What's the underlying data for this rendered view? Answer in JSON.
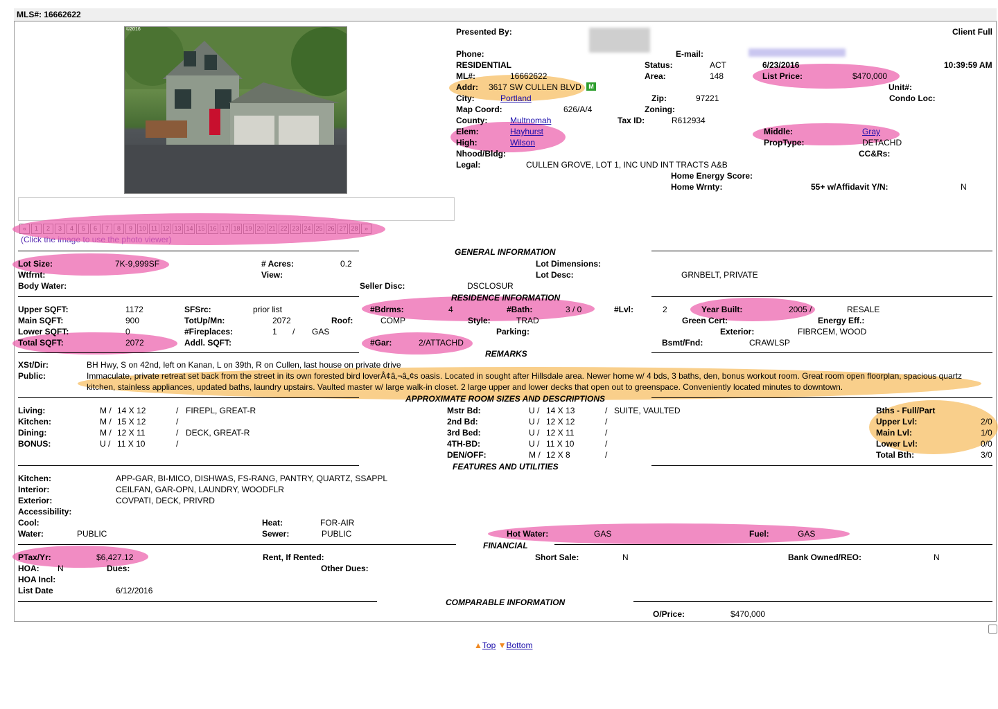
{
  "mls_header": "MLS#: 16662622",
  "photo_viewer_hint": "(Click the image to use the photo viewer)",
  "photo_caption": "©2016",
  "pager": [
    "«",
    "1",
    "2",
    "3",
    "4",
    "5",
    "6",
    "7",
    "8",
    "9",
    "10",
    "11",
    "12",
    "13",
    "14",
    "15",
    "16",
    "17",
    "18",
    "19",
    "20",
    "21",
    "22",
    "23",
    "24",
    "25",
    "26",
    "27",
    "28",
    "»"
  ],
  "listing": {
    "presented_by_label": "Presented By:",
    "client_full": "Client Full",
    "phone_label": "Phone:",
    "email_label": "E-mail:",
    "type": "RESIDENTIAL",
    "status_label": "Status:",
    "status": "ACT",
    "date": "6/23/2016",
    "time": "10:39:59 AM",
    "ml_label": "ML#:",
    "ml": "16662622",
    "area_label": "Area:",
    "area": "148",
    "list_price_label": "List Price:",
    "list_price": "$470,000",
    "addr_label": "Addr:",
    "addr": "3617 SW CULLEN BLVD",
    "map_badge": "M",
    "unit_label": "Unit#:",
    "city_label": "City:",
    "city": "Portland",
    "zip_label": "Zip:",
    "zip": "97221",
    "condo_label": "Condo Loc:",
    "map_coord_label": "Map Coord:",
    "map_coord": "626/A/4",
    "zoning_label": "Zoning:",
    "county_label": "County:",
    "county": "Multnomah",
    "taxid_label": "Tax ID:",
    "taxid": "R612934",
    "elem_label": "Elem:",
    "elem": "Hayhurst",
    "middle_label": "Middle:",
    "middle": "Gray",
    "high_label": "High:",
    "high": "Wilson",
    "proptype_label": "PropType:",
    "proptype": "DETACHD",
    "nhood_label": "Nhood/Bldg:",
    "ccrs_label": "CC&Rs:",
    "legal_label": "Legal:",
    "legal": "CULLEN GROVE, LOT 1, INC UND INT TRACTS A&B",
    "energy_label": "Home Energy Score:",
    "wrnty_label": "Home Wrnty:",
    "affidavit_label": "55+ w/Affidavit Y/N:",
    "affidavit": "N"
  },
  "general": {
    "title": "GENERAL INFORMATION",
    "lot_size_label": "Lot Size:",
    "lot_size": "7K-9,999SF",
    "acres_label": "# Acres:",
    "acres": "0.2",
    "lot_dim_label": "Lot Dimensions:",
    "wtfrnt_label": "Wtfrnt:",
    "view_label": "View:",
    "lot_desc_label": "Lot Desc:",
    "lot_desc": "GRNBELT, PRIVATE",
    "body_water_label": "Body Water:",
    "seller_disc_label": "Seller Disc:",
    "seller_disc": "DSCLOSUR"
  },
  "residence": {
    "title": "RESIDENCE INFORMATION",
    "upper_label": "Upper SQFT:",
    "upper": "1172",
    "sfsrc_label": "SFSrc:",
    "sfsrc": "prior list",
    "bdrms_label": "#Bdrms:",
    "bdrms": "4",
    "bath_label": "#Bath:",
    "bath": "3 / 0",
    "lvl_label": "#Lvl:",
    "lvl": "2",
    "year_label": "Year Built:",
    "year": "2005 /",
    "resale": "RESALE",
    "main_label": "Main SQFT:",
    "main": "900",
    "totup_label": "TotUp/Mn:",
    "totup": "2072",
    "roof_label": "Roof:",
    "roof": "COMP",
    "style_label": "Style:",
    "style": "TRAD",
    "green_label": "Green Cert:",
    "energy_eff_label": "Energy Eff.:",
    "lower_label": "Lower SQFT:",
    "lower": "0",
    "fireplaces_label": "#Fireplaces:",
    "fireplaces": "1",
    "fp_sep": "/",
    "fp_type": "GAS",
    "parking_label": "Parking:",
    "exterior_label": "Exterior:",
    "exterior": "FIBRCEM, WOOD",
    "total_label": "Total SQFT:",
    "total": "2072",
    "addl_label": "Addl. SQFT:",
    "gar_label": "#Gar:",
    "gar": "2/ATTACHD",
    "bsmt_label": "Bsmt/Fnd:",
    "bsmt": "CRAWLSP"
  },
  "remarks": {
    "title": "REMARKS",
    "xst_label": "XSt/Dir:",
    "xst": "BH Hwy, S on 42nd, left on Kanan, L on 39th, R on Cullen, last house on private drive",
    "public_label": "Public:",
    "public_line1": "Immaculate, private retreat set back from the street in its own forested bird loverÂ¢â‚¬â„¢s oasis. Located in sought after Hillsdale area. Newer home w/ 4 bds, 3 baths, den, bonus workout room. Great room open floorplan, spacious quartz",
    "public_line2": "kitchen, stainless appliances, updated baths, laundry upstairs. Vaulted master w/ large walk-in closet. 2 large upper and lower decks that open out to greenspace. Conveniently located minutes to downtown."
  },
  "rooms": {
    "title": "APPROXIMATE ROOM SIZES AND DESCRIPTIONS",
    "left": [
      {
        "name": "Living:",
        "lvl": "M /",
        "size": "14 X 12",
        "sep": "/",
        "desc": "FIREPL, GREAT-R"
      },
      {
        "name": "Kitchen:",
        "lvl": "M /",
        "size": "15 X 12",
        "sep": "/",
        "desc": ""
      },
      {
        "name": "Dining:",
        "lvl": "M /",
        "size": "12 X 11",
        "sep": "/",
        "desc": "DECK, GREAT-R"
      },
      {
        "name": "BONUS:",
        "lvl": "U /",
        "size": "11 X 10",
        "sep": "/",
        "desc": ""
      }
    ],
    "right": [
      {
        "name": "Mstr Bd:",
        "lvl": "U /",
        "size": "14 X 13",
        "sep": "/",
        "desc": "SUITE, VAULTED"
      },
      {
        "name": "2nd Bd:",
        "lvl": "U /",
        "size": "12 X 12",
        "sep": "/",
        "desc": ""
      },
      {
        "name": "3rd Bed:",
        "lvl": "U /",
        "size": "12 X 11",
        "sep": "/",
        "desc": ""
      },
      {
        "name": "4TH-BD:",
        "lvl": "U /",
        "size": "11 X 10",
        "sep": "/",
        "desc": ""
      },
      {
        "name": "DEN/OFF:",
        "lvl": "M /",
        "size": "12 X 8",
        "sep": "/",
        "desc": ""
      }
    ],
    "baths_title": "Bths - Full/Part",
    "baths": [
      {
        "name": "Upper Lvl:",
        "val": "2/0"
      },
      {
        "name": "Main Lvl:",
        "val": "1/0"
      },
      {
        "name": "Lower Lvl:",
        "val": "0/0"
      },
      {
        "name": "Total Bth:",
        "val": "3/0"
      }
    ]
  },
  "features": {
    "title": "FEATURES AND UTILITIES",
    "kitchen_label": "Kitchen:",
    "kitchen": "APP-GAR, BI-MICO, DISHWAS, FS-RANG, PANTRY, QUARTZ, SSAPPL",
    "interior_label": "Interior:",
    "interior": "CEILFAN, GAR-OPN, LAUNDRY, WOODFLR",
    "exterior_label": "Exterior:",
    "exterior": "COVPATI, DECK, PRIVRD",
    "access_label": "Accessibility:",
    "cool_label": "Cool:",
    "heat_label": "Heat:",
    "heat": "FOR-AIR",
    "water_label": "Water:",
    "water": "PUBLIC",
    "sewer_label": "Sewer:",
    "sewer": "PUBLIC",
    "hotwater_label": "Hot Water:",
    "hotwater": "GAS",
    "fuel_label": "Fuel:",
    "fuel": "GAS"
  },
  "financial": {
    "title": "FINANCIAL",
    "ptax_label": "PTax/Yr:",
    "ptax": "$6,427.12",
    "rent_label": "Rent, If Rented:",
    "short_label": "Short Sale:",
    "short": "N",
    "bank_label": "Bank Owned/REO:",
    "bank": "N",
    "hoa_label": "HOA:",
    "hoa": "N",
    "dues_label": "Dues:",
    "other_dues_label": "Other Dues:",
    "hoa_incl_label": "HOA Incl:",
    "list_date_label": "List Date",
    "list_date": "6/12/2016"
  },
  "comparable": {
    "title": "COMPARABLE INFORMATION",
    "oprice_label": "O/Price:",
    "oprice": "$470,000"
  },
  "footer": {
    "top": "Top",
    "bottom": "Bottom"
  }
}
